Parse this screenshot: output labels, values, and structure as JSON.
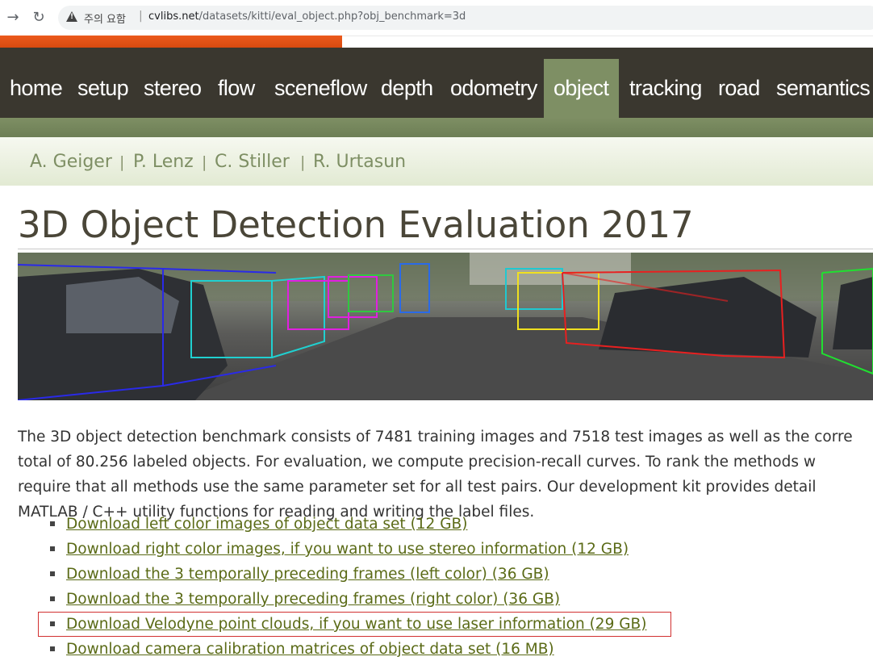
{
  "browser": {
    "security_label": "주의 요함",
    "url_host": "cvlibs.net",
    "url_path": "/datasets/kitti/eval_object.php?obj_benchmark=3d"
  },
  "nav": {
    "items": [
      {
        "label": "home"
      },
      {
        "label": "setup"
      },
      {
        "label": "stereo"
      },
      {
        "label": "flow"
      },
      {
        "label": "sceneflow"
      },
      {
        "label": "depth"
      },
      {
        "label": "odometry"
      },
      {
        "label": "object"
      },
      {
        "label": "tracking"
      },
      {
        "label": "road"
      },
      {
        "label": "semantics"
      }
    ],
    "active": "object"
  },
  "authors": [
    "A. Geiger",
    "P. Lenz",
    "C. Stiller",
    "R. Urtasun"
  ],
  "author_separator": "|",
  "page": {
    "title": "3D Object Detection Evaluation 2017",
    "description_lines": [
      "The 3D object detection benchmark consists of 7481 training images and 7518 test images as well as the corre",
      "total of 80.256 labeled objects. For evaluation, we compute precision-recall curves. To rank the methods w",
      "require that all methods use the same parameter set for all test pairs. Our development kit provides detail",
      "MATLAB / C++ utility functions for reading and writing the label files."
    ]
  },
  "downloads": [
    "Download left color images of object data set (12 GB)",
    "Download right color images, if you want to use stereo information (12 GB)",
    "Download the 3 temporally preceding frames (left color) (36 GB)",
    "Download the 3 temporally preceding frames (right color) (36 GB)",
    "Download Velodyne point clouds, if you want to use laser information (29 GB)",
    "Download camera calibration matrices of object data set (16 MB)"
  ],
  "colors": {
    "nav_bg": "#3a372f",
    "nav_active": "#7e8f64",
    "link": "#5a6a16",
    "highlight": "#d23030"
  }
}
